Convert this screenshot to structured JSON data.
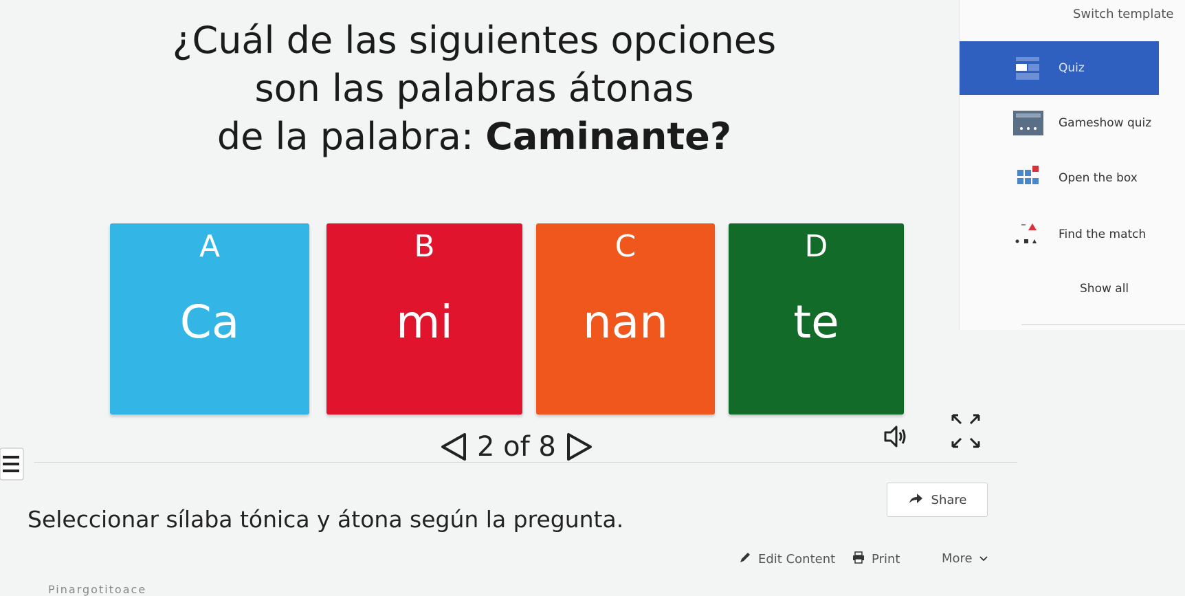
{
  "question": {
    "line1": "¿Cuál de las siguientes opciones",
    "line2": "son las palabras átonas",
    "line3_prefix": "de la palabra: ",
    "line3_bold": "Caminante?"
  },
  "answers": [
    {
      "letter": "A",
      "text": "Ca",
      "color": "#33b5e5"
    },
    {
      "letter": "B",
      "text": "mi",
      "color": "#e0142c"
    },
    {
      "letter": "C",
      "text": "nan",
      "color": "#f0571c"
    },
    {
      "letter": "D",
      "text": "te",
      "color": "#136b2a"
    }
  ],
  "pager": {
    "label": "2 of 8"
  },
  "description": "Seleccionar sílaba tónica y átona según la pregunta.",
  "actions": {
    "share": "Share",
    "edit": "Edit Content",
    "print": "Print",
    "more": "More"
  },
  "url_fragment": "Pinargotitoace",
  "sidebar": {
    "title": "Switch template",
    "templates": [
      {
        "name": "Quiz",
        "icon": "quiz-icon",
        "active": true
      },
      {
        "name": "Gameshow quiz",
        "icon": "gameshow-quiz-icon",
        "active": false
      },
      {
        "name": "Open the box",
        "icon": "open-the-box-icon",
        "active": false
      },
      {
        "name": "Find the match",
        "icon": "find-the-match-icon",
        "active": false
      }
    ],
    "show_all": "Show all"
  },
  "colors": {
    "accent": "#2f5fbf",
    "background": "#f3f4f4"
  }
}
